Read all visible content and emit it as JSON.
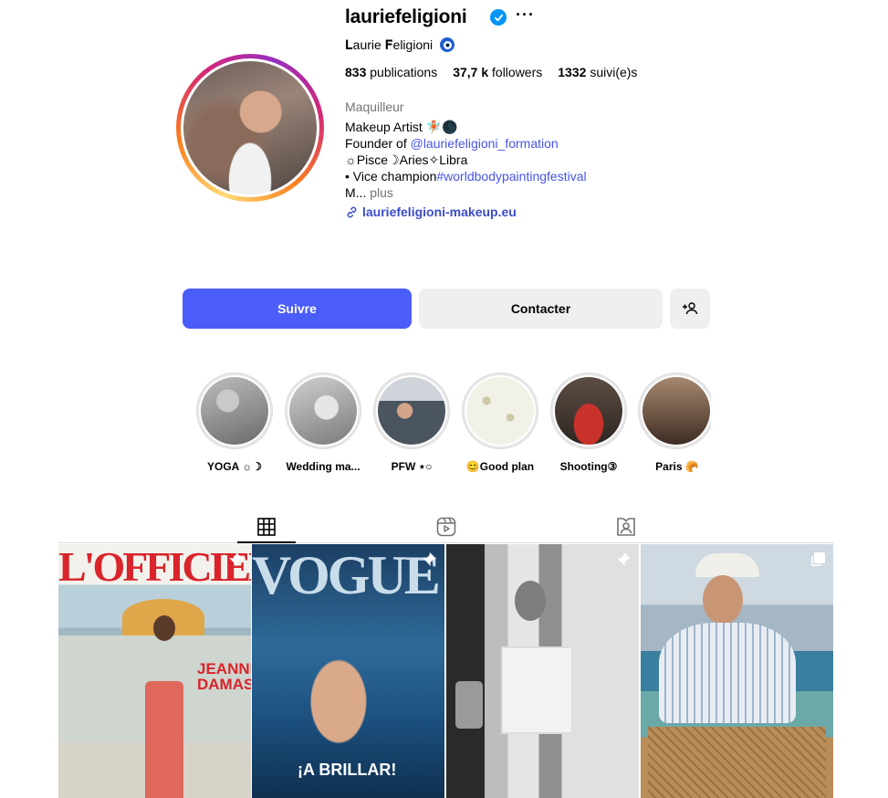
{
  "profile": {
    "username": "lauriefeligioni",
    "more_label": "···",
    "full_name": "𝐋aurie 𝐅eligioni",
    "stats": {
      "posts_count": "833",
      "posts_label": "publications",
      "followers_count": "37,7 k",
      "followers_label": "followers",
      "following_count": "1332",
      "following_label": "suivi(e)s"
    },
    "bio": {
      "category": "Maquilleur",
      "line1": "Makeup Artist 🧚🏼🌑",
      "line2_prefix": "Founder of ",
      "line2_mention": "@lauriefeligioni_formation",
      "line3": "☼Pisce☽Aries✧Libra",
      "line4_prefix": "• Vice champion",
      "line4_hashtag": "#worldbodypaintingfestival",
      "line5_prefix": "M... ",
      "line5_more": "plus"
    },
    "external_link": "lauriefeligioni-makeup.eu"
  },
  "actions": {
    "follow_label": "Suivre",
    "contact_label": "Contacter",
    "add_person_icon": "person-add-icon"
  },
  "highlights": [
    {
      "label": "YOGA ☼☽",
      "color": "#8f8f8f"
    },
    {
      "label": "Wedding ma...",
      "color": "#9b9b9b"
    },
    {
      "label": "PFW ⋆○",
      "color": "#6f7a86"
    },
    {
      "label": "😊Good plan",
      "color": "#e9e8de"
    },
    {
      "label": "Shooting③",
      "color": "#b8342c"
    },
    {
      "label": "Paris 🥐",
      "color": "#7b5e4b"
    }
  ],
  "tabs": [
    {
      "name": "posts",
      "icon": "grid-icon",
      "active": true
    },
    {
      "name": "reels",
      "icon": "reels-icon",
      "active": false
    },
    {
      "name": "tagged",
      "icon": "tagged-icon",
      "active": false
    }
  ],
  "posts": [
    {
      "title": "L'OFFICIEL",
      "sub": "JEANNE DAMAS",
      "pinned": true
    },
    {
      "title": "VOGUE",
      "sub": "¡A BRILLAR!",
      "pinned": true
    },
    {
      "title": "",
      "sub": "",
      "pinned": true
    },
    {
      "title": "",
      "sub": "",
      "pinned": false,
      "carousel": true
    }
  ]
}
